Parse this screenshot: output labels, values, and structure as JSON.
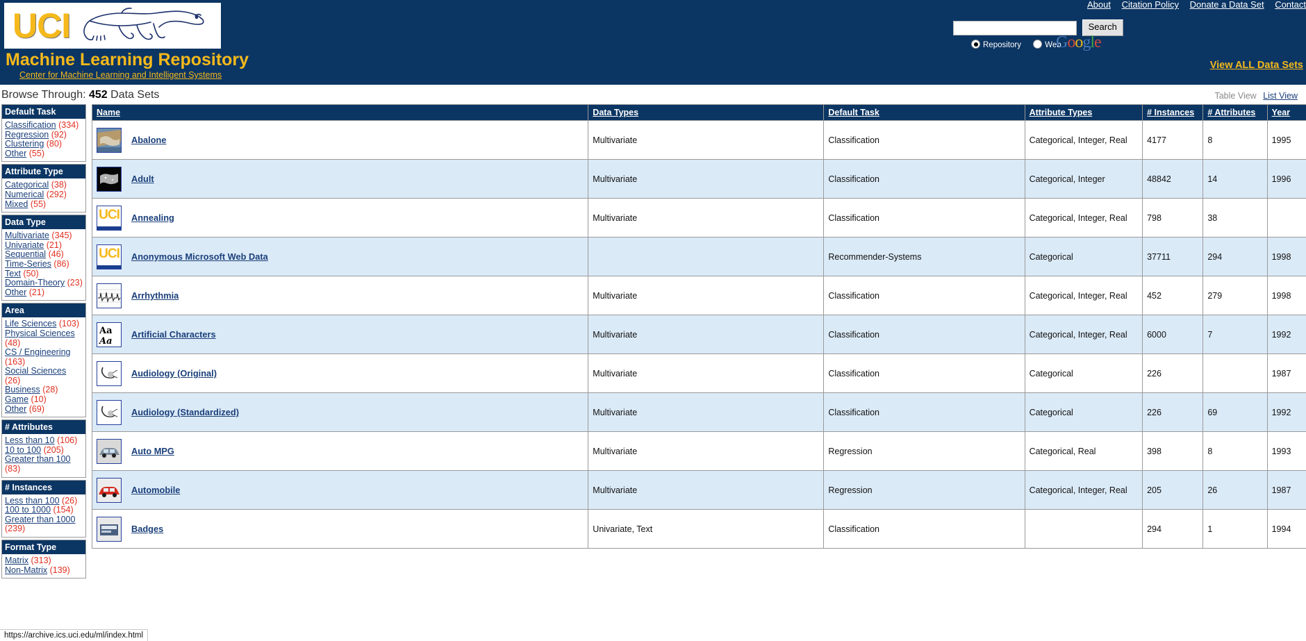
{
  "header": {
    "logo_text": "UCI",
    "site_title": "Machine Learning Repository",
    "center_link": "Center for Machine Learning and Intelligent Systems",
    "nav": [
      {
        "label": "About"
      },
      {
        "label": "Citation Policy"
      },
      {
        "label": "Donate a Data Set"
      },
      {
        "label": "Contact"
      }
    ],
    "search": {
      "value": "",
      "placeholder": "",
      "button_label": "Search",
      "scope_repository": "Repository",
      "scope_web": "Web",
      "selected_scope": "Repository",
      "provider": "Google"
    },
    "view_all_label": "View ALL Data Sets"
  },
  "browse": {
    "label": "Browse Through:",
    "count": "452",
    "count_suffix": "Data Sets",
    "table_view_label": "Table View",
    "list_view_label": "List View"
  },
  "sidebar": {
    "facets": [
      {
        "title": "Default Task",
        "items": [
          {
            "label": "Classification",
            "count": "(334)"
          },
          {
            "label": "Regression",
            "count": "(92)"
          },
          {
            "label": "Clustering",
            "count": "(80)"
          },
          {
            "label": "Other",
            "count": "(55)"
          }
        ]
      },
      {
        "title": "Attribute Type",
        "items": [
          {
            "label": "Categorical",
            "count": "(38)"
          },
          {
            "label": "Numerical",
            "count": "(292)"
          },
          {
            "label": "Mixed",
            "count": "(55)"
          }
        ]
      },
      {
        "title": "Data Type",
        "items": [
          {
            "label": "Multivariate",
            "count": "(345)"
          },
          {
            "label": "Univariate",
            "count": "(21)"
          },
          {
            "label": "Sequential",
            "count": "(46)"
          },
          {
            "label": "Time-Series",
            "count": "(86)"
          },
          {
            "label": "Text",
            "count": "(50)"
          },
          {
            "label": "Domain-Theory",
            "count": "(23)"
          },
          {
            "label": "Other",
            "count": "(21)"
          }
        ]
      },
      {
        "title": "Area",
        "items": [
          {
            "label": "Life Sciences",
            "count": "(103)"
          },
          {
            "label": "Physical Sciences",
            "count": "(48)"
          },
          {
            "label": "CS / Engineering",
            "count": "(163)"
          },
          {
            "label": "Social Sciences",
            "count": "(26)"
          },
          {
            "label": "Business",
            "count": "(28)"
          },
          {
            "label": "Game",
            "count": "(10)"
          },
          {
            "label": "Other",
            "count": "(69)"
          }
        ]
      },
      {
        "title": "# Attributes",
        "items": [
          {
            "label": "Less than 10",
            "count": "(106)"
          },
          {
            "label": "10 to 100",
            "count": "(205)"
          },
          {
            "label": "Greater than 100",
            "count": "(83)"
          }
        ]
      },
      {
        "title": "# Instances",
        "items": [
          {
            "label": "Less than 100",
            "count": "(26)"
          },
          {
            "label": "100 to 1000",
            "count": "(154)"
          },
          {
            "label": "Greater than 1000",
            "count": "(239)"
          }
        ]
      },
      {
        "title": "Format Type",
        "items": [
          {
            "label": "Matrix",
            "count": "(313)"
          },
          {
            "label": "Non-Matrix",
            "count": "(139)"
          }
        ]
      }
    ]
  },
  "table": {
    "columns": [
      {
        "label": "Name"
      },
      {
        "label": "Data Types"
      },
      {
        "label": "Default Task"
      },
      {
        "label": "Attribute Types"
      },
      {
        "label": "# Instances"
      },
      {
        "label": "# Attributes"
      },
      {
        "label": "Year"
      }
    ],
    "rows": [
      {
        "name": "Abalone",
        "thumb": "abalone-photo-thumbnail",
        "data_types": "Multivariate",
        "default_task": "Classification",
        "attribute_types": "Categorical, Integer, Real",
        "instances": "4177",
        "attributes": "8",
        "year": "1995"
      },
      {
        "name": "Adult",
        "thumb": "adult-map-thumbnail",
        "data_types": "Multivariate",
        "default_task": "Classification",
        "attribute_types": "Categorical, Integer",
        "instances": "48842",
        "attributes": "14",
        "year": "1996"
      },
      {
        "name": "Annealing",
        "thumb": "uci-logo-thumbnail",
        "data_types": "Multivariate",
        "default_task": "Classification",
        "attribute_types": "Categorical, Integer, Real",
        "instances": "798",
        "attributes": "38",
        "year": ""
      },
      {
        "name": "Anonymous Microsoft Web Data",
        "thumb": "uci-logo-thumbnail",
        "data_types": "",
        "default_task": "Recommender-Systems",
        "attribute_types": "Categorical",
        "instances": "37711",
        "attributes": "294",
        "year": "1998"
      },
      {
        "name": "Arrhythmia",
        "thumb": "ecg-chart-thumbnail",
        "data_types": "Multivariate",
        "default_task": "Classification",
        "attribute_types": "Categorical, Integer, Real",
        "instances": "452",
        "attributes": "279",
        "year": "1998"
      },
      {
        "name": "Artificial Characters",
        "thumb": "letters-aa-thumbnail",
        "data_types": "Multivariate",
        "default_task": "Classification",
        "attribute_types": "Categorical, Integer, Real",
        "instances": "6000",
        "attributes": "7",
        "year": "1992"
      },
      {
        "name": "Audiology (Original)",
        "thumb": "ear-anatomy-thumbnail",
        "data_types": "Multivariate",
        "default_task": "Classification",
        "attribute_types": "Categorical",
        "instances": "226",
        "attributes": "",
        "year": "1987"
      },
      {
        "name": "Audiology (Standardized)",
        "thumb": "ear-anatomy-thumbnail",
        "data_types": "Multivariate",
        "default_task": "Classification",
        "attribute_types": "Categorical",
        "instances": "226",
        "attributes": "69",
        "year": "1992"
      },
      {
        "name": "Auto MPG",
        "thumb": "car-photo-thumbnail",
        "data_types": "Multivariate",
        "default_task": "Regression",
        "attribute_types": "Categorical, Real",
        "instances": "398",
        "attributes": "8",
        "year": "1993"
      },
      {
        "name": "Automobile",
        "thumb": "red-car-thumbnail",
        "data_types": "Multivariate",
        "default_task": "Regression",
        "attribute_types": "Categorical, Integer, Real",
        "instances": "205",
        "attributes": "26",
        "year": "1987"
      },
      {
        "name": "Badges",
        "thumb": "badges-thumbnail",
        "data_types": "Univariate, Text",
        "default_task": "Classification",
        "attribute_types": "",
        "instances": "294",
        "attributes": "1",
        "year": "1994"
      }
    ]
  },
  "statusbar": {
    "text": "https://archive.ics.uci.edu/ml/index.html"
  }
}
